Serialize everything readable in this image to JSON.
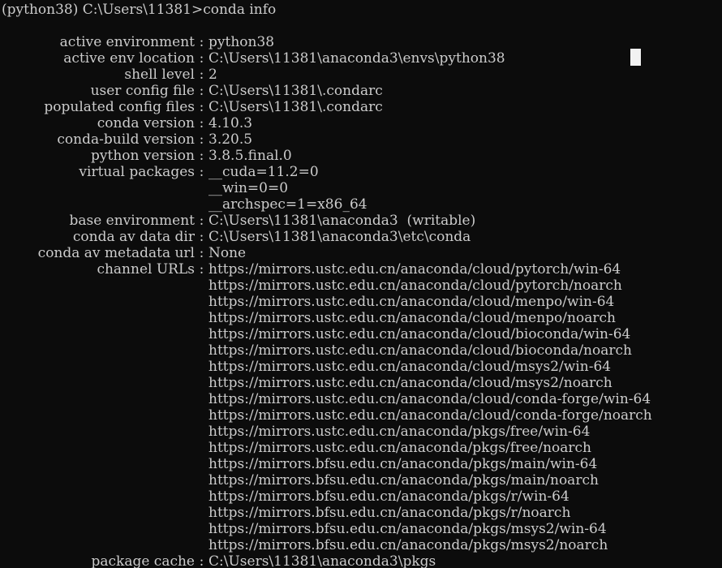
{
  "terminal": {
    "background_color": "#0c0c0c",
    "text_color": "#cccccc",
    "cursor_color": "#f2f2f2",
    "prompt_line": "(python38) C:\\Users\\11381>conda info",
    "command": "conda info",
    "prompt": "(python38) C:\\Users\\11381>"
  },
  "info": {
    "rows": [
      {
        "key": "active environment",
        "sep": ":",
        "value": "python38"
      },
      {
        "key": "active env location",
        "sep": ":",
        "value": "C:\\Users\\11381\\anaconda3\\envs\\python38"
      },
      {
        "key": "shell level",
        "sep": ":",
        "value": "2"
      },
      {
        "key": "user config file",
        "sep": ":",
        "value": "C:\\Users\\11381\\.condarc"
      },
      {
        "key": "populated config files",
        "sep": ":",
        "value": "C:\\Users\\11381\\.condarc"
      },
      {
        "key": "conda version",
        "sep": ":",
        "value": "4.10.3"
      },
      {
        "key": "conda-build version",
        "sep": ":",
        "value": "3.20.5"
      },
      {
        "key": "python version",
        "sep": ":",
        "value": "3.8.5.final.0"
      },
      {
        "key": "virtual packages",
        "sep": ":",
        "value": "__cuda=11.2=0"
      },
      {
        "key": "",
        "sep": "",
        "value": "__win=0=0",
        "continuation": true
      },
      {
        "key": "",
        "sep": "",
        "value": "__archspec=1=x86_64",
        "continuation": true
      },
      {
        "key": "base environment",
        "sep": ":",
        "value": "C:\\Users\\11381\\anaconda3  (writable)"
      },
      {
        "key": "conda av data dir",
        "sep": ":",
        "value": "C:\\Users\\11381\\anaconda3\\etc\\conda"
      },
      {
        "key": "conda av metadata url",
        "sep": ":",
        "value": "None"
      },
      {
        "key": "channel URLs",
        "sep": ":",
        "value": "https://mirrors.ustc.edu.cn/anaconda/cloud/pytorch/win-64"
      },
      {
        "key": "",
        "sep": "",
        "value": "https://mirrors.ustc.edu.cn/anaconda/cloud/pytorch/noarch",
        "continuation": true
      },
      {
        "key": "",
        "sep": "",
        "value": "https://mirrors.ustc.edu.cn/anaconda/cloud/menpo/win-64",
        "continuation": true
      },
      {
        "key": "",
        "sep": "",
        "value": "https://mirrors.ustc.edu.cn/anaconda/cloud/menpo/noarch",
        "continuation": true
      },
      {
        "key": "",
        "sep": "",
        "value": "https://mirrors.ustc.edu.cn/anaconda/cloud/bioconda/win-64",
        "continuation": true
      },
      {
        "key": "",
        "sep": "",
        "value": "https://mirrors.ustc.edu.cn/anaconda/cloud/bioconda/noarch",
        "continuation": true
      },
      {
        "key": "",
        "sep": "",
        "value": "https://mirrors.ustc.edu.cn/anaconda/cloud/msys2/win-64",
        "continuation": true
      },
      {
        "key": "",
        "sep": "",
        "value": "https://mirrors.ustc.edu.cn/anaconda/cloud/msys2/noarch",
        "continuation": true
      },
      {
        "key": "",
        "sep": "",
        "value": "https://mirrors.ustc.edu.cn/anaconda/cloud/conda-forge/win-64",
        "continuation": true
      },
      {
        "key": "",
        "sep": "",
        "value": "https://mirrors.ustc.edu.cn/anaconda/cloud/conda-forge/noarch",
        "continuation": true
      },
      {
        "key": "",
        "sep": "",
        "value": "https://mirrors.ustc.edu.cn/anaconda/pkgs/free/win-64",
        "continuation": true
      },
      {
        "key": "",
        "sep": "",
        "value": "https://mirrors.ustc.edu.cn/anaconda/pkgs/free/noarch",
        "continuation": true
      },
      {
        "key": "",
        "sep": "",
        "value": "https://mirrors.bfsu.edu.cn/anaconda/pkgs/main/win-64",
        "continuation": true
      },
      {
        "key": "",
        "sep": "",
        "value": "https://mirrors.bfsu.edu.cn/anaconda/pkgs/main/noarch",
        "continuation": true
      },
      {
        "key": "",
        "sep": "",
        "value": "https://mirrors.bfsu.edu.cn/anaconda/pkgs/r/win-64",
        "continuation": true
      },
      {
        "key": "",
        "sep": "",
        "value": "https://mirrors.bfsu.edu.cn/anaconda/pkgs/r/noarch",
        "continuation": true
      },
      {
        "key": "",
        "sep": "",
        "value": "https://mirrors.bfsu.edu.cn/anaconda/pkgs/msys2/win-64",
        "continuation": true
      },
      {
        "key": "",
        "sep": "",
        "value": "https://mirrors.bfsu.edu.cn/anaconda/pkgs/msys2/noarch",
        "continuation": true
      },
      {
        "key": "package cache",
        "sep": ":",
        "value": "C:\\Users\\11381\\anaconda3\\pkgs"
      }
    ]
  }
}
